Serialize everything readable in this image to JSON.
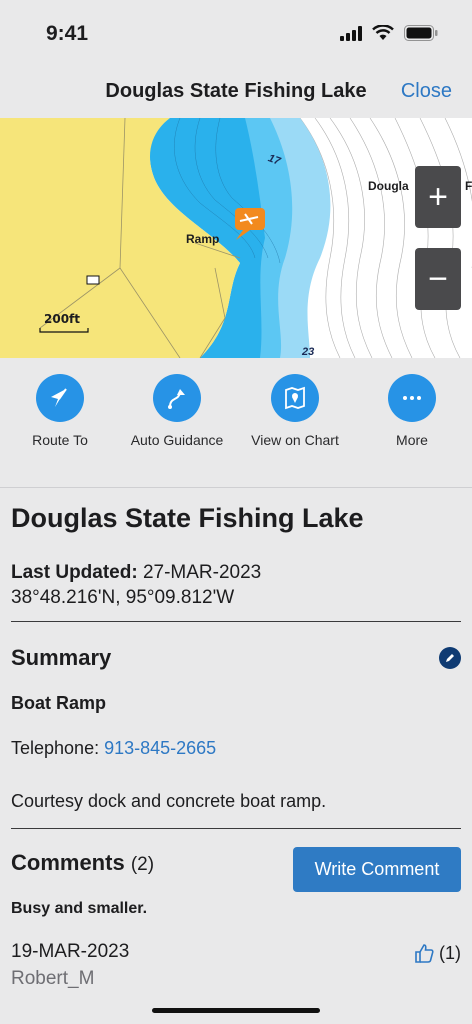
{
  "status": {
    "time": "9:41"
  },
  "nav": {
    "title": "Douglas State Fishing Lake",
    "close": "Close"
  },
  "map": {
    "ramp_label": "Ramp",
    "douglas_label": "Dougla",
    "f_label": "F",
    "scale_label": "200ft",
    "depth_17": "17",
    "depth_23": "23",
    "zoom_in": "+",
    "zoom_out": "−",
    "colors": {
      "land": "#f6e57a",
      "deep": "#2ab1ec",
      "shallow": "#9bdaf6"
    }
  },
  "actions": [
    {
      "label": "Route To",
      "icon": "route-arrow-icon"
    },
    {
      "label": "Auto Guidance",
      "icon": "auto-guidance-icon"
    },
    {
      "label": "View on Chart",
      "icon": "map-pin-icon"
    },
    {
      "label": "More",
      "icon": "more-dots-icon"
    }
  ],
  "detail": {
    "title": "Douglas State Fishing Lake",
    "updated_label": "Last Updated:",
    "updated_date": "27-MAR-2023",
    "coords": "38°48.216'N, 95°09.812'W",
    "summary_heading": "Summary",
    "type": "Boat Ramp",
    "telephone_label": "Telephone:",
    "telephone": "913-845-2665",
    "description": "Courtesy dock and concrete boat ramp.",
    "comments_heading": "Comments",
    "comments_count": "(2)",
    "write_comment": "Write Comment",
    "comment": {
      "title": "Busy and smaller.",
      "date": "19-MAR-2023",
      "author": "Robert_M",
      "likes": "(1)"
    }
  }
}
